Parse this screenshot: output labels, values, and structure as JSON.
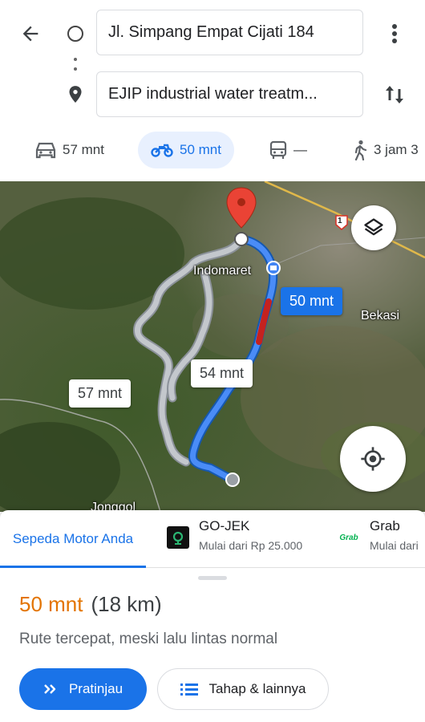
{
  "header": {
    "origin": "Jl. Simpang Empat Cijati 184",
    "destination": "EJIP industrial water treatm...",
    "icons": {
      "back": "back-arrow-icon",
      "menu": "more-vert-icon",
      "swap": "swap-vert-icon"
    }
  },
  "modes": [
    {
      "icon": "car-icon",
      "label": "57 mnt"
    },
    {
      "icon": "motorcycle-icon",
      "label": "50 mnt",
      "active": true
    },
    {
      "icon": "transit-icon",
      "label": "—"
    },
    {
      "icon": "walk-icon",
      "label": "3 jam 3"
    }
  ],
  "map": {
    "labels": {
      "indomaret": "Indomaret",
      "bekasi": "Bekasi",
      "jonggol": "Jonggol",
      "highway": "1"
    },
    "routes": [
      {
        "label": "50 mnt",
        "primary": true
      },
      {
        "label": "54 mnt"
      },
      {
        "label": "57 mnt"
      }
    ]
  },
  "sheet": {
    "tabs": {
      "own": "Sepeda Motor Anda",
      "gojek": {
        "name": "GO-JEK",
        "sub": "Mulai dari Rp 25.000"
      },
      "grab": {
        "name": "Grab",
        "sub": "Mulai dari",
        "logo_text": "Grab"
      }
    },
    "duration": "50 mnt",
    "distance": "(18 km)",
    "summary": "Rute tercepat, meski lalu lintas normal",
    "buttons": {
      "preview": "Pratinjau",
      "steps": "Tahap & lainnya"
    }
  },
  "colors": {
    "accent": "#1a73e8",
    "time": "#e37400",
    "traffic": "#d93025"
  }
}
